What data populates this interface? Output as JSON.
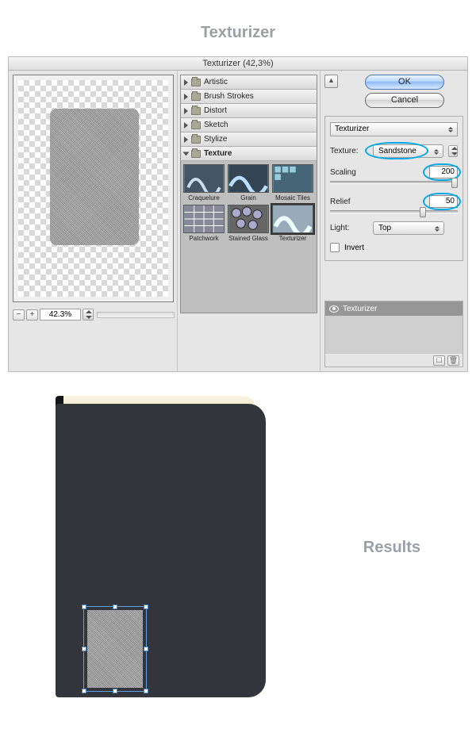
{
  "headings": {
    "top": "Texturizer",
    "results": "Results"
  },
  "dialog": {
    "title": "Texturizer (42,3%)",
    "zoom": "42.3%",
    "categories": [
      {
        "label": "Artistic",
        "open": false
      },
      {
        "label": "Brush Strokes",
        "open": false
      },
      {
        "label": "Distort",
        "open": false
      },
      {
        "label": "Sketch",
        "open": false
      },
      {
        "label": "Stylize",
        "open": false
      },
      {
        "label": "Texture",
        "open": true
      }
    ],
    "thumbs": [
      {
        "label": "Craquelure"
      },
      {
        "label": "Grain"
      },
      {
        "label": "Mosaic Tiles"
      },
      {
        "label": "Patchwork"
      },
      {
        "label": "Stained Glass"
      },
      {
        "label": "Texturizer",
        "selected": true
      }
    ],
    "buttons": {
      "ok": "OK",
      "cancel": "Cancel"
    },
    "filterName": "Texturizer",
    "options": {
      "textureLabel": "Texture:",
      "textureValue": "Sandstone",
      "scalingLabel": "Scaling",
      "scalingValue": "200",
      "reliefLabel": "Relief",
      "reliefValue": "50",
      "lightLabel": "Light:",
      "lightValue": "Top",
      "invertLabel": "Invert"
    },
    "layerName": "Texturizer"
  }
}
